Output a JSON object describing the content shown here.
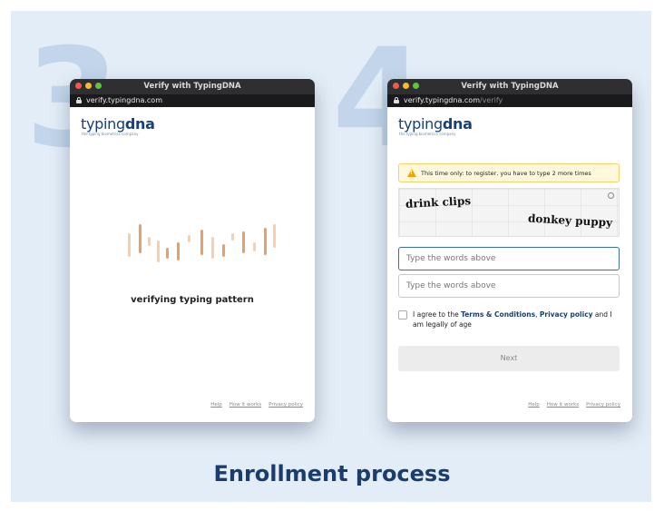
{
  "steps": {
    "left_number": "3",
    "right_number": "4"
  },
  "left_window": {
    "title": "Verify with TypingDNA",
    "url": "verify.typingdna.com",
    "logo_regular": "typing",
    "logo_bold": "dna",
    "tagline": "the typing biometrics company",
    "status_text": "verifying typing pattern",
    "footer": {
      "help": "Help",
      "how": "How it works",
      "privacy": "Privacy policy"
    }
  },
  "right_window": {
    "title": "Verify with TypingDNA",
    "url_host": "verify.typingdna.com",
    "url_path": "/verify",
    "logo_regular": "typing",
    "logo_bold": "dna",
    "tagline": "the typing biometrics company",
    "alert_text": "This time only: to register, you have to type 2 more times",
    "captcha_words_1": "drink clips",
    "captcha_words_2": "donkey puppy",
    "field1_placeholder": "Type the words above",
    "field2_placeholder": "Type the words above",
    "agree": {
      "prefix": "I agree to the ",
      "terms": "Terms & Conditions",
      "sep": ", ",
      "privacy": "Privacy policy",
      "suffix": " and I am legally of age"
    },
    "next_label": "Next",
    "footer": {
      "help": "Help",
      "how": "How it works",
      "privacy": "Privacy policy"
    }
  },
  "caption": "Enrollment process",
  "colors": {
    "accent": "#17407a",
    "bar_orange": "#e8a06a",
    "bar_light": "#f5cfae",
    "warning": "#f0a500"
  },
  "icons": {
    "lock": "lock-icon",
    "warning": "warning-icon",
    "refresh": "refresh-icon"
  }
}
